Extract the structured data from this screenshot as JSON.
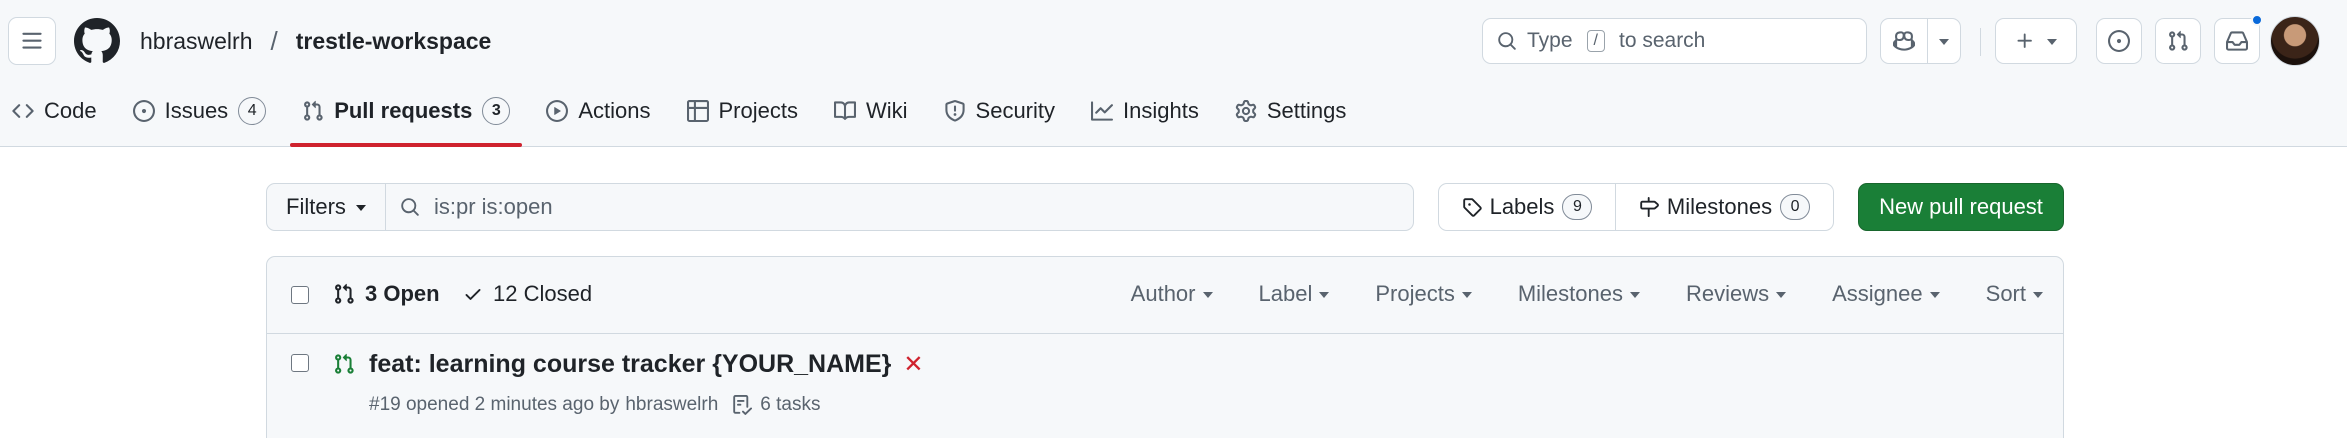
{
  "header": {
    "owner": "hbraswelrh",
    "separator": "/",
    "repo": "trestle-workspace",
    "search": {
      "prefix": "Type",
      "key": "/",
      "suffix": "to search"
    }
  },
  "nav": {
    "tabs": [
      {
        "label": "Code",
        "icon": "code-icon"
      },
      {
        "label": "Issues",
        "icon": "issue-opened-icon",
        "count": "4"
      },
      {
        "label": "Pull requests",
        "icon": "git-pull-request-icon",
        "count": "3",
        "selected": true
      },
      {
        "label": "Actions",
        "icon": "play-icon"
      },
      {
        "label": "Projects",
        "icon": "table-icon"
      },
      {
        "label": "Wiki",
        "icon": "book-icon"
      },
      {
        "label": "Security",
        "icon": "shield-icon"
      },
      {
        "label": "Insights",
        "icon": "graph-icon"
      },
      {
        "label": "Settings",
        "icon": "gear-icon"
      }
    ]
  },
  "toolbar": {
    "filters_label": "Filters",
    "query": "is:pr is:open",
    "labels_label": "Labels",
    "labels_count": "9",
    "milestones_label": "Milestones",
    "milestones_count": "0",
    "new_pr_label": "New pull request"
  },
  "list": {
    "open_label": "3 Open",
    "closed_label": "12 Closed",
    "sorters": [
      "Author",
      "Label",
      "Projects",
      "Milestones",
      "Reviews",
      "Assignee",
      "Sort"
    ],
    "rows": [
      {
        "title": "feat: learning course tracker {YOUR_NAME}",
        "status_mark": "✕",
        "meta_prefix": "#19 opened 2 minutes ago by",
        "author": "hbraswelrh",
        "tasks": "6 tasks"
      }
    ]
  },
  "colors": {
    "accent_underline": "#cf222e",
    "primary_button": "#1a7f37",
    "notification_dot": "#0969da",
    "status_fail": "#cf222e",
    "open_icon": "#1a7f37"
  }
}
